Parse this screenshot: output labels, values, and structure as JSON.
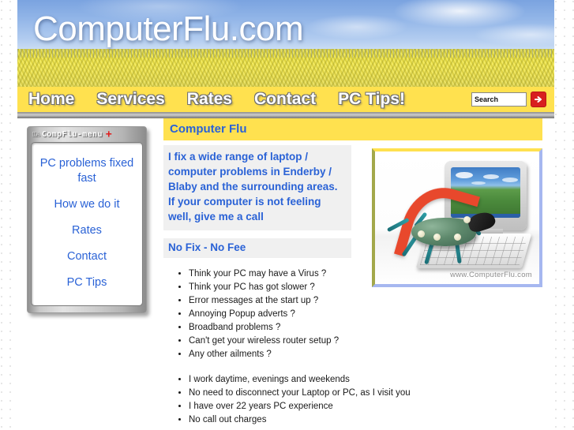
{
  "header": {
    "site_title": "ComputerFlu.com"
  },
  "nav": {
    "items": [
      {
        "label": "Home",
        "active": true
      },
      {
        "label": "Services",
        "active": false
      },
      {
        "label": "Rates",
        "active": false
      },
      {
        "label": "Contact",
        "active": false
      },
      {
        "label": "PC Tips!",
        "active": false
      }
    ],
    "search": {
      "value": "Search",
      "placeholder": "Search",
      "go_icon": "arrow-right-icon"
    }
  },
  "sidebar": {
    "title_icon": "menu-glyph-icon",
    "title": "CompFlu-menu",
    "title_plus": "+",
    "items": [
      {
        "label": "PC problems fixed fast"
      },
      {
        "label": "How we do it"
      },
      {
        "label": "Rates"
      },
      {
        "label": "Contact"
      },
      {
        "label": "PC Tips"
      }
    ]
  },
  "main": {
    "panel_title": "Computer Flu",
    "intro": "I fix a wide range of laptop / computer problems in Enderby / Blaby and the surrounding areas. If your computer is not feeling well, give me a call",
    "no_fix_no_fee": "No Fix - No Fee",
    "questions": [
      "Think your PC may have a Virus ?",
      "Think your PC has got slower ?",
      "Error messages at the start up ?",
      "Annoying Popup adverts ?",
      "Broadband problems ?",
      "Can't get your wireless router setup ?",
      "Any other ailments ?"
    ],
    "benefits": [
      "I work daytime, evenings and weekends",
      "No need to disconnect your Laptop or PC, as I visit you",
      "I have over 22 years PC experience",
      "No call out charges"
    ],
    "image": {
      "alt": "computer-virus-bug-illustration",
      "watermark": "www.ComputerFlu.com"
    }
  },
  "colors": {
    "banner_sky": "#7aa3e0",
    "field_yellow": "#e8dc3e",
    "nav_yellow": "#ffe14f",
    "active_tab": "#a6b7f0",
    "link_blue": "#2a62d6",
    "search_go_red": "#d81f1f",
    "panel_bg": "#f0f0f0"
  }
}
